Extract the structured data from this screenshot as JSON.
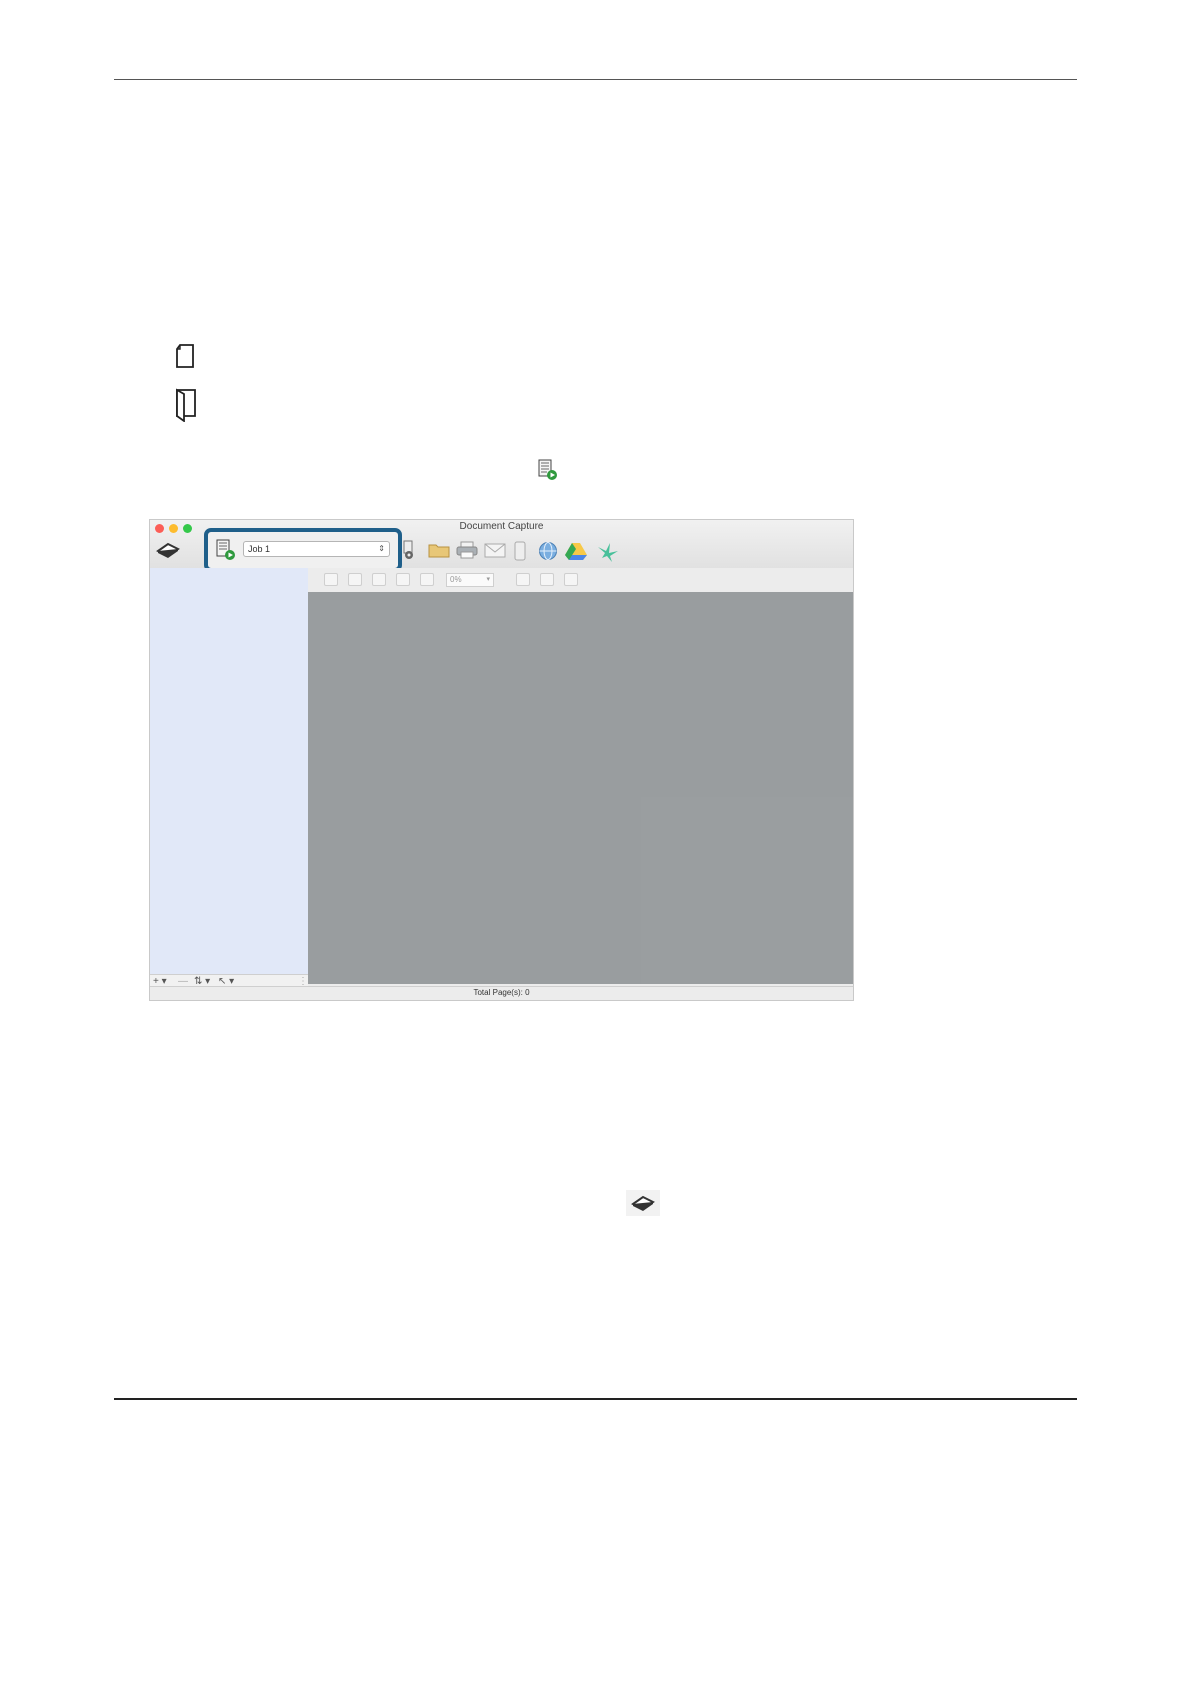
{
  "app": {
    "window_title": "Document Capture",
    "job_selector_value": "Job 1",
    "status_total_pages": "Total Page(s): 0",
    "zoom_value": "0%"
  },
  "colors": {
    "highlight_border": "#1f5f8a",
    "sidebar_bg": "#e1e8f8",
    "viewer_bg": "#999d9f"
  },
  "icons": {
    "single_sided": "single-sided-document-icon",
    "double_sided": "double-sided-document-icon",
    "scan_job": "scan-job-icon",
    "scan": "scan-icon"
  }
}
